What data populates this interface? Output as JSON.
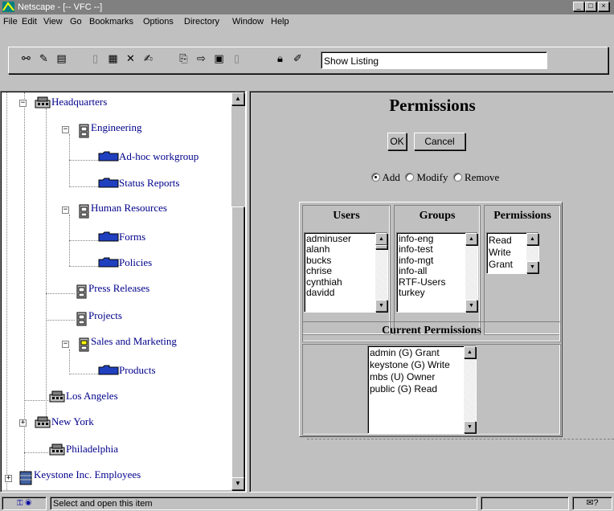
{
  "window": {
    "title": "Netscape - [-- VFC --]",
    "controls": [
      "_",
      "□",
      "×"
    ]
  },
  "menu": [
    "File",
    "Edit",
    "View",
    "Go",
    "Bookmarks",
    "Options",
    "Directory",
    "Window",
    "Help"
  ],
  "toolbar": {
    "location_value": "Show Listing"
  },
  "tree": {
    "items": [
      {
        "label": "Headquarters",
        "icon": "building-icon"
      },
      {
        "label": "Engineering",
        "icon": "cabinet-icon"
      },
      {
        "label": "Ad-hoc workgroup",
        "icon": "folder-icon"
      },
      {
        "label": "Status Reports",
        "icon": "folder-icon"
      },
      {
        "label": "Human Resources",
        "icon": "cabinet-icon"
      },
      {
        "label": "Forms",
        "icon": "folder-icon"
      },
      {
        "label": "Policies",
        "icon": "folder-icon"
      },
      {
        "label": "Press Releases",
        "icon": "cabinet-icon"
      },
      {
        "label": "Projects",
        "icon": "cabinet-icon"
      },
      {
        "label": "Sales and Marketing",
        "icon": "cabinet-icon"
      },
      {
        "label": "Products",
        "icon": "folder-icon"
      },
      {
        "label": "Los Angeles",
        "icon": "building-icon"
      },
      {
        "label": "New York",
        "icon": "building-icon"
      },
      {
        "label": "Philadelphia",
        "icon": "building-icon"
      },
      {
        "label": "Keystone Inc. Employees",
        "icon": "people-icon"
      }
    ]
  },
  "permissions_panel": {
    "title": "Permissions",
    "ok_label": "OK",
    "cancel_label": "Cancel",
    "radio": {
      "add": "Add",
      "modify": "Modify",
      "remove": "Remove",
      "selected": "add"
    },
    "users_header": "Users",
    "groups_header": "Groups",
    "permissions_header": "Permissions",
    "users": [
      "adminuser",
      "alanh",
      "bucks",
      "chrise",
      "cynthiah",
      "davidd"
    ],
    "groups": [
      "info-eng",
      "info-test",
      "info-mgt",
      "info-all",
      "RTF-Users",
      "turkey"
    ],
    "permissions": [
      "Read",
      "Write",
      "Grant"
    ],
    "current_header": "Current Permissions",
    "current": [
      "admin (G) Grant",
      "keystone (G) Write",
      "mbs (U) Owner",
      "public (G) Read"
    ]
  },
  "status": {
    "text": "Select and open this item"
  }
}
